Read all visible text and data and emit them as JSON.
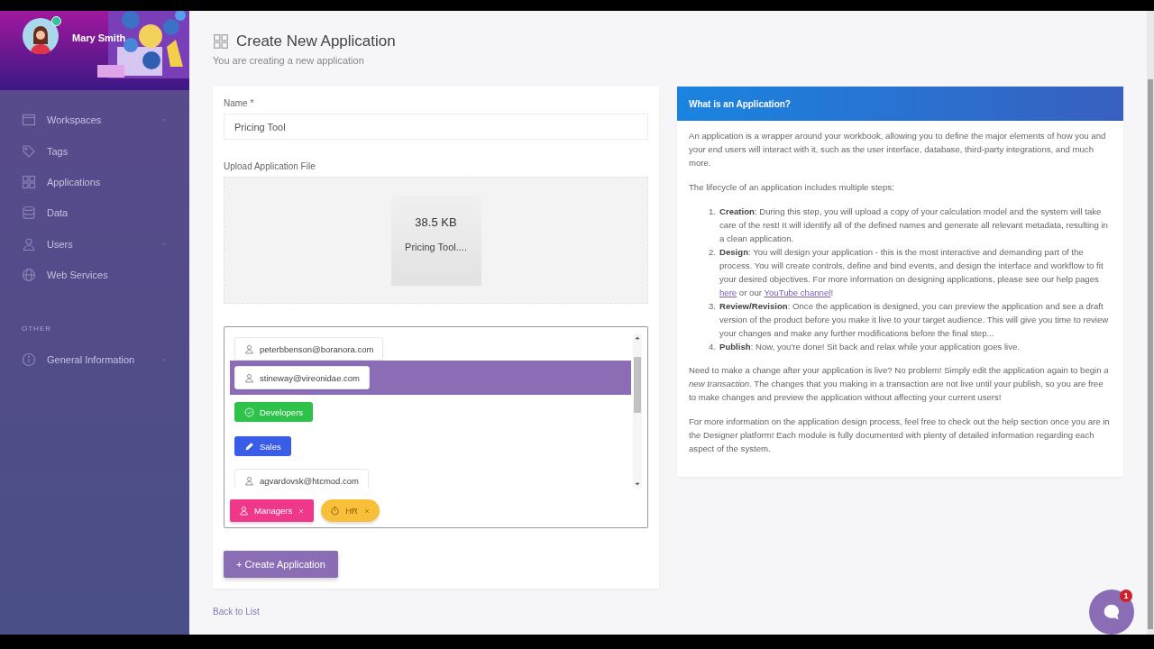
{
  "sidebar": {
    "user": {
      "name": "Mary Smith",
      "online": true
    },
    "items": [
      {
        "label": "Workspaces",
        "expandable": true,
        "selected": false
      },
      {
        "label": "Tags",
        "expandable": false,
        "selected": false
      },
      {
        "label": "Applications",
        "expandable": false,
        "selected": false
      },
      {
        "label": "Data",
        "expandable": false,
        "selected": false
      },
      {
        "label": "Users",
        "expandable": true,
        "selected": false
      },
      {
        "label": "Web Services",
        "expandable": false,
        "selected": false
      }
    ],
    "section": "OTHER",
    "other_items": [
      {
        "label": "General Information",
        "expandable": true,
        "selected": false
      }
    ]
  },
  "page": {
    "title": "Create New Application",
    "subtitle": "You are creating a new application"
  },
  "form": {
    "name_label": "Name *",
    "name_value": "Pricing Tool",
    "upload_label": "Upload Application File",
    "file": {
      "size": "38.5 KB",
      "name": "Pricing Tool...."
    },
    "picker_options": [
      {
        "kind": "user",
        "label": "peterbbenson@boranora.com",
        "selected": false
      },
      {
        "kind": "user",
        "label": "stineway@vireonidae.com",
        "selected": true
      },
      {
        "kind": "group",
        "label": "Developers",
        "color": "#2ec24a",
        "selected": false
      },
      {
        "kind": "group",
        "label": "Sales",
        "color": "#3a5de8",
        "selected": false
      },
      {
        "kind": "user",
        "label": "agvardovsk@htcmod.com",
        "selected": false
      }
    ],
    "chosen": [
      {
        "label": "Managers",
        "color": "#f0388a"
      },
      {
        "label": "HR",
        "color": "#f8c03a"
      }
    ],
    "submit": "+ Create Application"
  },
  "back_link": "Back to List",
  "info": {
    "title": "What is an Application?",
    "intro": "An application is a wrapper around your workbook, allowing you to define the major elements of how you and your end users will interact with it, such as the user interface, database, third-party integrations, and much more.",
    "lead": "The lifecycle of an application includes multiple steps:",
    "steps": [
      {
        "number": "1.",
        "term": "Creation",
        "parts": [
          {
            "kind": "text",
            "text": ": During this step, you will upload a copy of your calculation model and the system will take care of the rest! It will identify all of the defined names and generate all relevant metadata, resulting in a clean application."
          }
        ]
      },
      {
        "number": "2.",
        "term": "Design",
        "parts": [
          {
            "kind": "text",
            "text": ": You will design your application - this is the most interactive and demanding part of the process. You will create controls, define and bind events, and design the interface and workflow to fit your desired objectives. For more information on designing applications, please see our help pages "
          },
          {
            "kind": "link",
            "text": "here"
          },
          {
            "kind": "text",
            "text": " or our "
          },
          {
            "kind": "link",
            "text": "YouTube channel"
          },
          {
            "kind": "text",
            "text": "!"
          }
        ]
      },
      {
        "number": "3.",
        "term": "Review/Revision",
        "parts": [
          {
            "kind": "text",
            "text": ": Once the application is designed, you can preview the application and see a draft version of the product before you make it live to your target audience. This will give you time to review your changes and make any further modifications before the final step..."
          }
        ]
      },
      {
        "number": "4.",
        "term": "Publish",
        "parts": [
          {
            "kind": "text",
            "text": ": Now, you're done! Sit back and relax while your application goes live."
          }
        ]
      }
    ],
    "paragraphs": [
      "Need to make a change after your application is live? No problem! Simply edit the application again to begin *a new transaction*. The changes that you making in a transaction are not live until your publish, so you are free to make changes and preview the application without affecting your current users!",
      "For more information on the application design process, feel free to check out the help section once you are in the Designer platform! Each module is fully documented with plenty of detailed information regarding each aspect of the system."
    ]
  },
  "chat": {
    "badge": "1"
  }
}
